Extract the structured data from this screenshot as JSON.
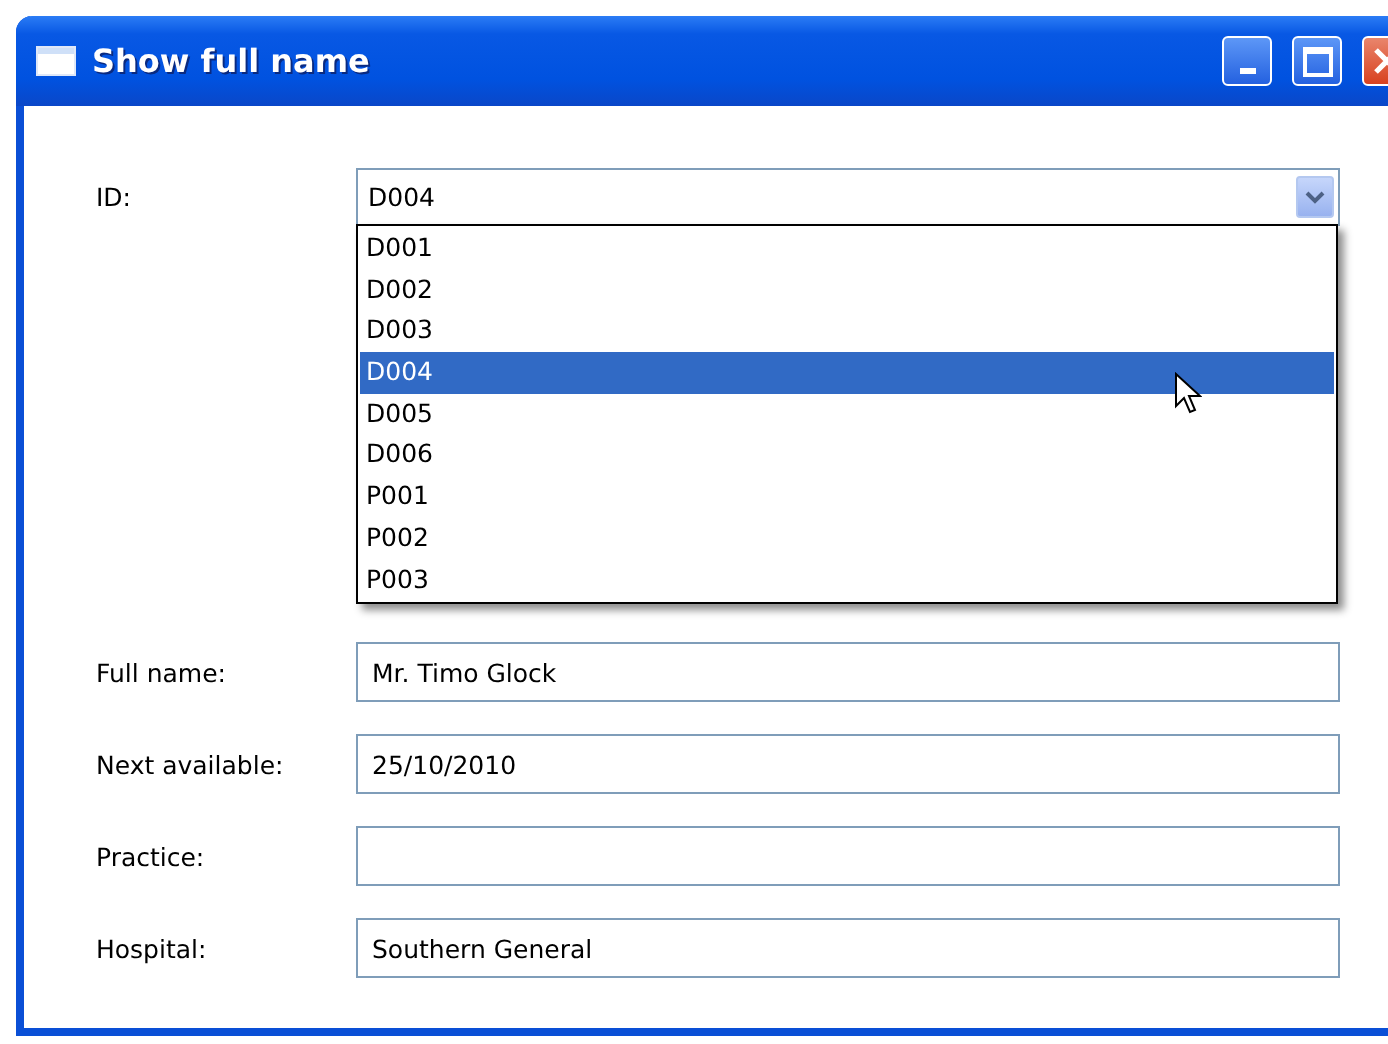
{
  "window": {
    "title": "Show full name"
  },
  "id_field": {
    "label": "ID:",
    "value": "D004",
    "expanded": true,
    "options": [
      {
        "label": "D001",
        "selected": false
      },
      {
        "label": "D002",
        "selected": false
      },
      {
        "label": "D003",
        "selected": false
      },
      {
        "label": "D004",
        "selected": true
      },
      {
        "label": "D005",
        "selected": false
      },
      {
        "label": "D006",
        "selected": false
      },
      {
        "label": "P001",
        "selected": false
      },
      {
        "label": "P002",
        "selected": false
      },
      {
        "label": "P003",
        "selected": false
      }
    ]
  },
  "fields": [
    {
      "label": "Full name:",
      "value": "Mr. Timo Glock"
    },
    {
      "label": "Next available:",
      "value": "25/10/2010"
    },
    {
      "label": "Practice:"
    },
    {
      "label": "Hospital:",
      "value": "Southern General"
    }
  ]
}
